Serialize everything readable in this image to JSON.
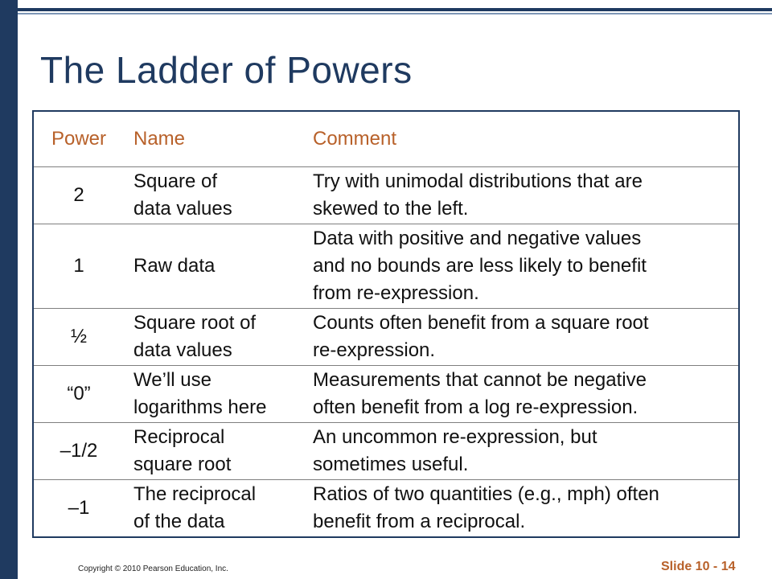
{
  "slide": {
    "title": "The Ladder of Powers",
    "copyright": "Copyright © 2010 Pearson Education, Inc.",
    "slide_label": "Slide 10 - 14"
  },
  "table": {
    "headers": {
      "power": "Power",
      "name": "Name",
      "comment": "Comment"
    },
    "rows": [
      {
        "power": "2",
        "name": [
          "Square of",
          "data values"
        ],
        "comment": [
          "Try with unimodal distributions that are",
          "skewed to the left."
        ]
      },
      {
        "power": "1",
        "name": [
          "Raw data"
        ],
        "comment": [
          "Data with positive and negative values",
          "and no bounds are less likely to benefit",
          "from re-expression."
        ]
      },
      {
        "power": "½",
        "name": [
          "Square root of",
          "data values"
        ],
        "comment": [
          "Counts often benefit from a square root",
          "re-expression."
        ]
      },
      {
        "power": "“0”",
        "name": [
          "We’ll use",
          "logarithms here"
        ],
        "comment": [
          "Measurements that cannot be negative",
          "often benefit from a log re-expression."
        ]
      },
      {
        "power": "–1/2",
        "name": [
          "Reciprocal",
          "square root"
        ],
        "comment": [
          "An uncommon re-expression, but",
          "sometimes useful."
        ]
      },
      {
        "power": "–1",
        "name": [
          "The reciprocal",
          "of the data"
        ],
        "comment": [
          "Ratios of two quantities (e.g., mph) often",
          "benefit from a reciprocal."
        ]
      }
    ]
  },
  "colors": {
    "primary": "#1f3a60",
    "accent": "#b8612a"
  }
}
